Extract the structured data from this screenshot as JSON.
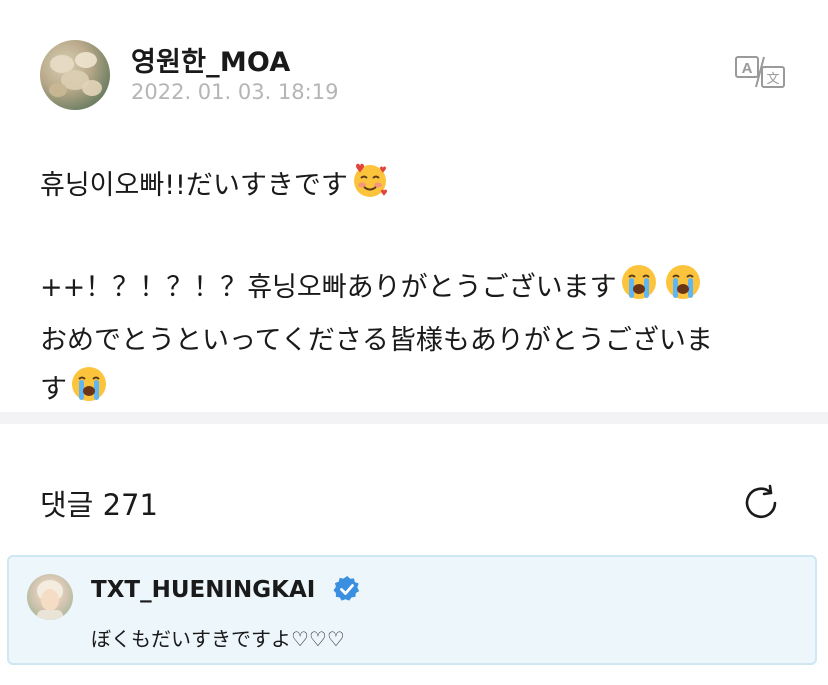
{
  "post": {
    "author": "영원한_MOA",
    "date": "2022. 01. 03. 18:19",
    "avatar_icon": "profile-photo",
    "translate_icon": "translate-icon",
    "line1": "휴닝이오빠!!だいすきです",
    "line2": "++！？！？！？휴닝오빠ありがとうございます",
    "line3": "おめでとうといってくださる皆様もありがとうございま",
    "line4": "す"
  },
  "comments": {
    "label": "댓글 271",
    "refresh_icon": "refresh-icon"
  },
  "highlighted_comment": {
    "author": "TXT_HUENINGKAI",
    "verified_icon": "verified-badge-icon",
    "verified_color": "#3b8fe0",
    "text": "ぼくもだいすきですよ♡♡♡",
    "background_color": "#ecf6fb"
  }
}
